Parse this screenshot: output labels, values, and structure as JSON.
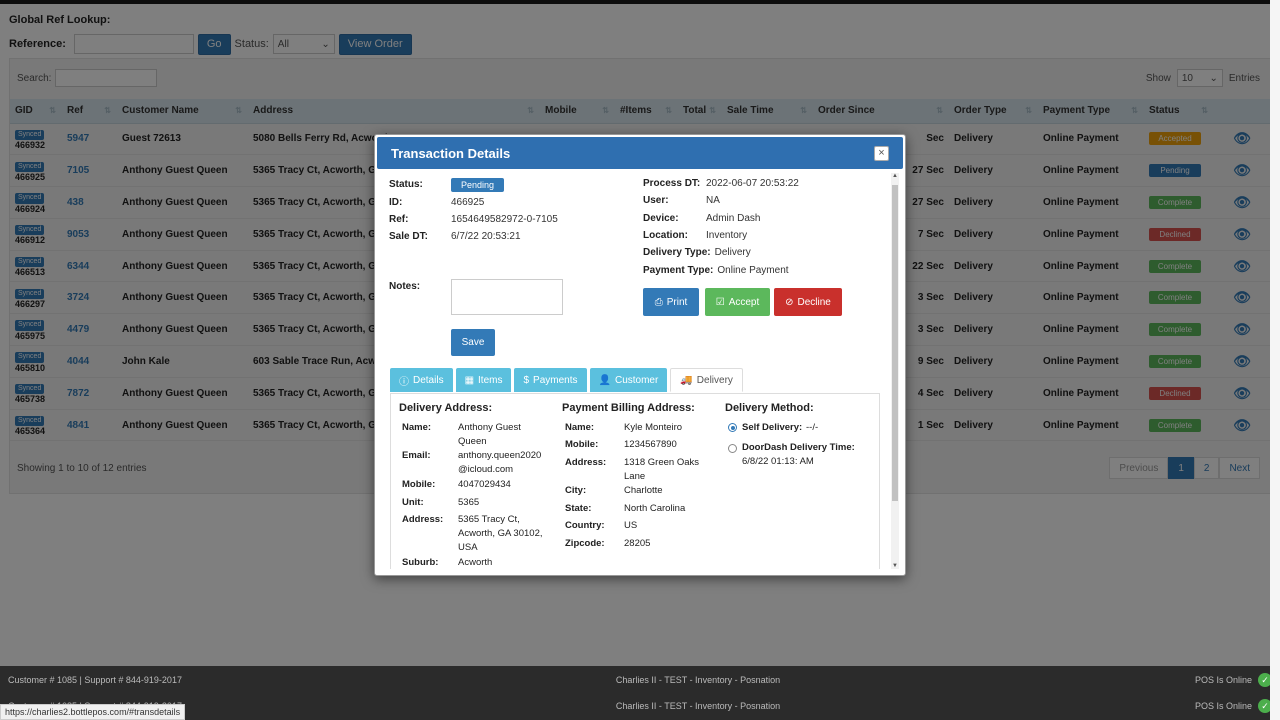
{
  "lookup": {
    "title": "Global Ref Lookup:",
    "reference_label": "Reference:",
    "reference_value": "",
    "go_label": "Go",
    "status_label": "Status:",
    "status_value": "All",
    "view_order_label": "View Order"
  },
  "table_controls": {
    "search_label": "Search:",
    "search_value": "",
    "show_label": "Show",
    "show_value": "10",
    "entries_label": "Entries"
  },
  "table": {
    "columns": [
      "GID",
      "Ref",
      "Customer Name",
      "Address",
      "Mobile",
      "#Items",
      "Total",
      "Sale Time",
      "Order Since",
      "Order Type",
      "Payment Type",
      "Status"
    ],
    "synced_label": "Synced",
    "rows": [
      {
        "gid": "466932",
        "ref": "5947",
        "name": "Guest 72613",
        "address": "5080 Bells Ferry Rd, Acworth, GA 30102, USA, 30102",
        "order_since": "Sec",
        "order_type": "Delivery",
        "payment": "Online Payment",
        "status": "Accepted",
        "status_color": "#f0a30a"
      },
      {
        "gid": "466925",
        "ref": "7105",
        "name": "Anthony Guest Queen",
        "address": "5365 Tracy Ct, Acworth, GA 30102",
        "order_since": "27 Sec",
        "order_type": "Delivery",
        "payment": "Online Payment",
        "status": "Pending",
        "status_color": "#337ab7"
      },
      {
        "gid": "466924",
        "ref": "438",
        "name": "Anthony Guest Queen",
        "address": "5365 Tracy Ct, Acworth, GA 30102",
        "order_since": "27 Sec",
        "order_type": "Delivery",
        "payment": "Online Payment",
        "status": "Complete",
        "status_color": "#5cb85c"
      },
      {
        "gid": "466912",
        "ref": "9053",
        "name": "Anthony Guest Queen",
        "address": "5365 Tracy Ct, Acworth, GA 30102",
        "order_since": "7 Sec",
        "order_type": "Delivery",
        "payment": "Online Payment",
        "status": "Declined",
        "status_color": "#d9534f"
      },
      {
        "gid": "466513",
        "ref": "6344",
        "name": "Anthony Guest Queen",
        "address": "5365 Tracy Ct, Acworth, GA 30102",
        "order_since": "22 Sec",
        "order_type": "Delivery",
        "payment": "Online Payment",
        "status": "Complete",
        "status_color": "#5cb85c"
      },
      {
        "gid": "466297",
        "ref": "3724",
        "name": "Anthony Guest Queen",
        "address": "5365 Tracy Ct, Acworth, GA 30102",
        "order_since": "3 Sec",
        "order_type": "Delivery",
        "payment": "Online Payment",
        "status": "Complete",
        "status_color": "#5cb85c"
      },
      {
        "gid": "465975",
        "ref": "4479",
        "name": "Anthony Guest Queen",
        "address": "5365 Tracy Ct, Acworth, GA 30102",
        "order_since": "3 Sec",
        "order_type": "Delivery",
        "payment": "Online Payment",
        "status": "Complete",
        "status_color": "#5cb85c"
      },
      {
        "gid": "465810",
        "ref": "4044",
        "name": "John Kale",
        "address": "603 Sable Trace Run, Acworth",
        "order_since": "9 Sec",
        "order_type": "Delivery",
        "payment": "Online Payment",
        "status": "Complete",
        "status_color": "#5cb85c"
      },
      {
        "gid": "465738",
        "ref": "7872",
        "name": "Anthony Guest Queen",
        "address": "5365 Tracy Ct, Acworth, GA 30102",
        "order_since": "4 Sec",
        "order_type": "Delivery",
        "payment": "Online Payment",
        "status": "Declined",
        "status_color": "#d9534f"
      },
      {
        "gid": "465364",
        "ref": "4841",
        "name": "Anthony Guest Queen",
        "address": "5365 Tracy Ct, Acworth, GA 30102",
        "order_since": "1 Sec",
        "order_type": "Delivery",
        "payment": "Online Payment",
        "status": "Complete",
        "status_color": "#5cb85c"
      }
    ],
    "showing": "Showing 1 to 10 of 12 entries",
    "pager": {
      "previous": "Previous",
      "page1": "1",
      "page2": "2",
      "next": "Next"
    }
  },
  "footer": {
    "customer": "Customer # 1085 | Support # 844-919-2017",
    "store": "Charlies II - TEST - Inventory - Posnation",
    "pos_status": "POS Is Online"
  },
  "status_url": "https://charlies2.bottlepos.com/#transdetails",
  "modal": {
    "title": "Transaction Details",
    "close": "×",
    "status_label": "Status:",
    "status_value": "Pending",
    "id_label": "ID:",
    "id_value": "466925",
    "ref_label": "Ref:",
    "ref_value": "1654649582972-0-7105",
    "sale_dt_label": "Sale DT:",
    "sale_dt_value": "6/7/22 20:53:21",
    "process_dt_label": "Process DT:",
    "process_dt_value": "2022-06-07 20:53:22",
    "user_label": "User:",
    "user_value": "NA",
    "device_label": "Device:",
    "device_value": "Admin Dash",
    "location_label": "Location:",
    "location_value": "Inventory",
    "delivery_type_label": "Delivery Type:",
    "delivery_type_value": "Delivery",
    "payment_type_label": "Payment Type:",
    "payment_type_value": "Online Payment",
    "notes_label": "Notes:",
    "notes_value": "",
    "save_label": "Save",
    "print_label": "Print",
    "accept_label": "Accept",
    "decline_label": "Decline",
    "tabs": [
      "Details",
      "Items",
      "Payments",
      "Customer",
      "Delivery"
    ],
    "delivery": {
      "address_title": "Delivery Address:",
      "name_label": "Name:",
      "name_value_1": "Anthony Guest",
      "name_value_2": "Queen",
      "email_label": "Email:",
      "email_value_1": "anthony.queen2020",
      "email_value_2": "@icloud.com",
      "mobile_label": "Mobile:",
      "mobile_value": "4047029434",
      "unit_label": "Unit:",
      "unit_value": "5365",
      "address_label": "Address:",
      "address_value_1": "5365 Tracy Ct,",
      "address_value_2": "Acworth, GA 30102,",
      "address_value_3": "USA",
      "suburb_label": "Suburb:",
      "suburb_value": "Acworth"
    },
    "billing": {
      "title": "Payment Billing Address:",
      "name_label": "Name:",
      "name_value": "Kyle Monteiro",
      "mobile_label": "Mobile:",
      "mobile_value": "1234567890",
      "address_label": "Address:",
      "address_value_1": "1318 Green Oaks",
      "address_value_2": "Lane",
      "city_label": "City:",
      "city_value": "Charlotte",
      "state_label": "State:",
      "state_value": "North Carolina",
      "country_label": "Country:",
      "country_value": "US",
      "zipcode_label": "Zipcode:",
      "zipcode_value": "28205"
    },
    "method": {
      "title": "Delivery Method:",
      "self_label": "Self Delivery:",
      "self_value": "--/-",
      "doordash_label": "DoorDash Delivery Time:",
      "doordash_value": "6/8/22 01:13: AM"
    }
  }
}
